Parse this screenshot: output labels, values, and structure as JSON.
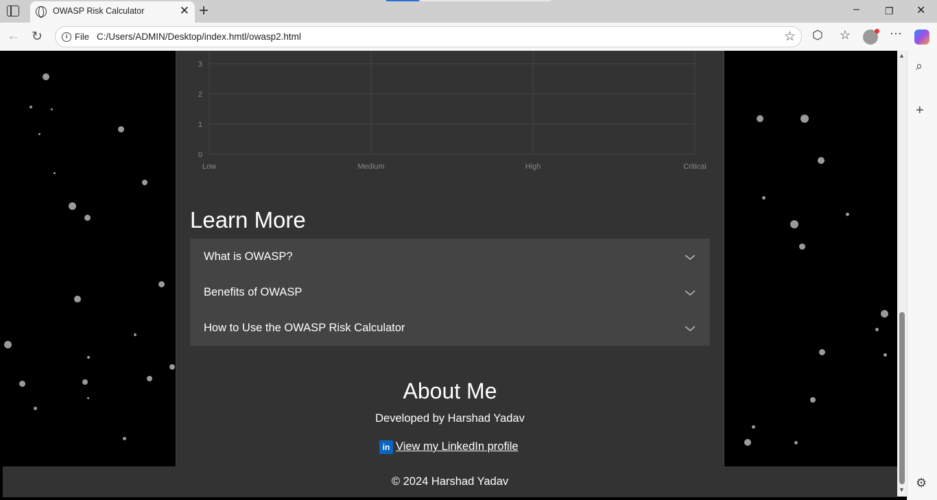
{
  "browser": {
    "tab_title": "OWASP Risk Calculator",
    "address_scheme": "File",
    "address_url": "C:/Users/ADMIN/Desktop/index.hmtl/owasp2.html"
  },
  "chart_data": {
    "type": "bar",
    "categories": [
      "Low",
      "Medium",
      "High",
      "Critical"
    ],
    "y_ticks_visible": [
      0,
      1,
      2,
      3
    ],
    "values": [
      0,
      0,
      0,
      0
    ],
    "grid": true
  },
  "learn_more": {
    "title": "Learn More",
    "items": [
      {
        "label": "What is OWASP?"
      },
      {
        "label": "Benefits of OWASP"
      },
      {
        "label": "How to Use the OWASP Risk Calculator"
      }
    ]
  },
  "about": {
    "title": "About Me",
    "developer": "Developed by Harshad Yadav",
    "linkedin_label": " View my LinkedIn profile",
    "linkedin_icon_text": "in"
  },
  "footer": {
    "text": "© 2024 Harshad Yadav"
  },
  "colors": {
    "page_bg": "#000000",
    "container_bg": "#333333",
    "accordion_bg": "#444444",
    "linkedin_blue": "#0a66c2"
  }
}
